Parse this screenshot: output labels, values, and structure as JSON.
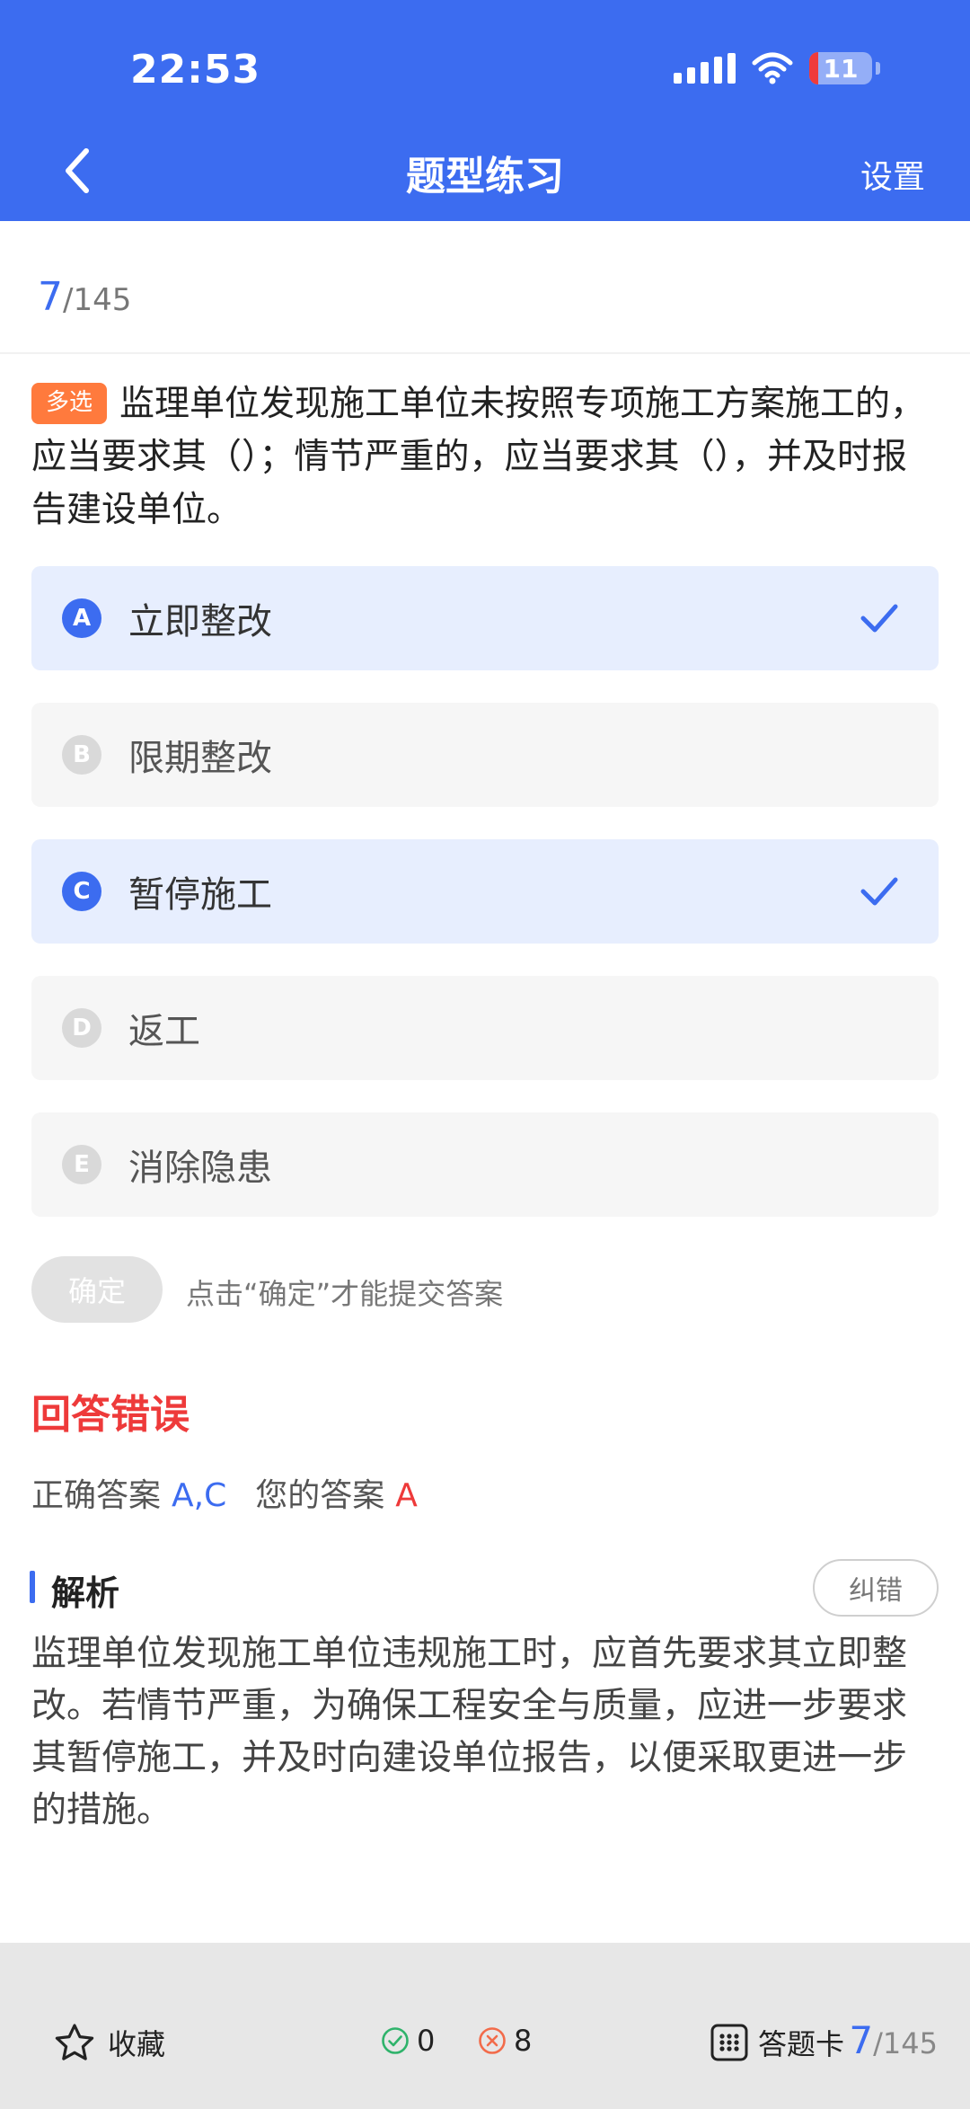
{
  "status_bar": {
    "time": "22:53",
    "battery": "11"
  },
  "header": {
    "title": "题型练习",
    "settings_label": "设置"
  },
  "progress": {
    "current": "7",
    "total": "/145"
  },
  "question": {
    "type_tag": "多选",
    "text": "监理单位发现施工单位未按照专项施工方案施工的，应当要求其（）；情节严重的，应当要求其（），并及时报告建设单位。"
  },
  "options": [
    {
      "letter": "A",
      "text": "立即整改",
      "selected": true
    },
    {
      "letter": "B",
      "text": "限期整改",
      "selected": false
    },
    {
      "letter": "C",
      "text": "暂停施工",
      "selected": true
    },
    {
      "letter": "D",
      "text": "返工",
      "selected": false
    },
    {
      "letter": "E",
      "text": "消除隐患",
      "selected": false
    }
  ],
  "confirm": {
    "label": "确定",
    "hint": "点击“确定”才能提交答案"
  },
  "result": {
    "title": "回答错误",
    "correct_label": "正确答案",
    "correct_value": "A,C",
    "mine_label": "您的答案",
    "mine_value": "A"
  },
  "analysis": {
    "title": "解析",
    "report_label": "纠错",
    "text": "监理单位发现施工单位违规施工时，应首先要求其立即整改。若情节严重，为确保工程安全与质量，应进一步要求其暂停施工，并及时向建设单位报告，以便采取更进一步的措施。"
  },
  "bottom_bar": {
    "favorite_label": "收藏",
    "right_count": "0",
    "wrong_count": "8",
    "card_label": "答题卡",
    "progress_current": "7",
    "progress_total": "/145"
  },
  "colors": {
    "primary": "#3c6cf0",
    "error": "#ee3a3a",
    "tag": "#ff7a3d",
    "success": "#2fb36b"
  },
  "icons": {
    "back": "chevron-left-icon",
    "check": "check-icon",
    "favorite": "star-outline-icon",
    "right": "check-circle-icon",
    "wrong": "x-circle-icon",
    "card": "grid-icon"
  }
}
